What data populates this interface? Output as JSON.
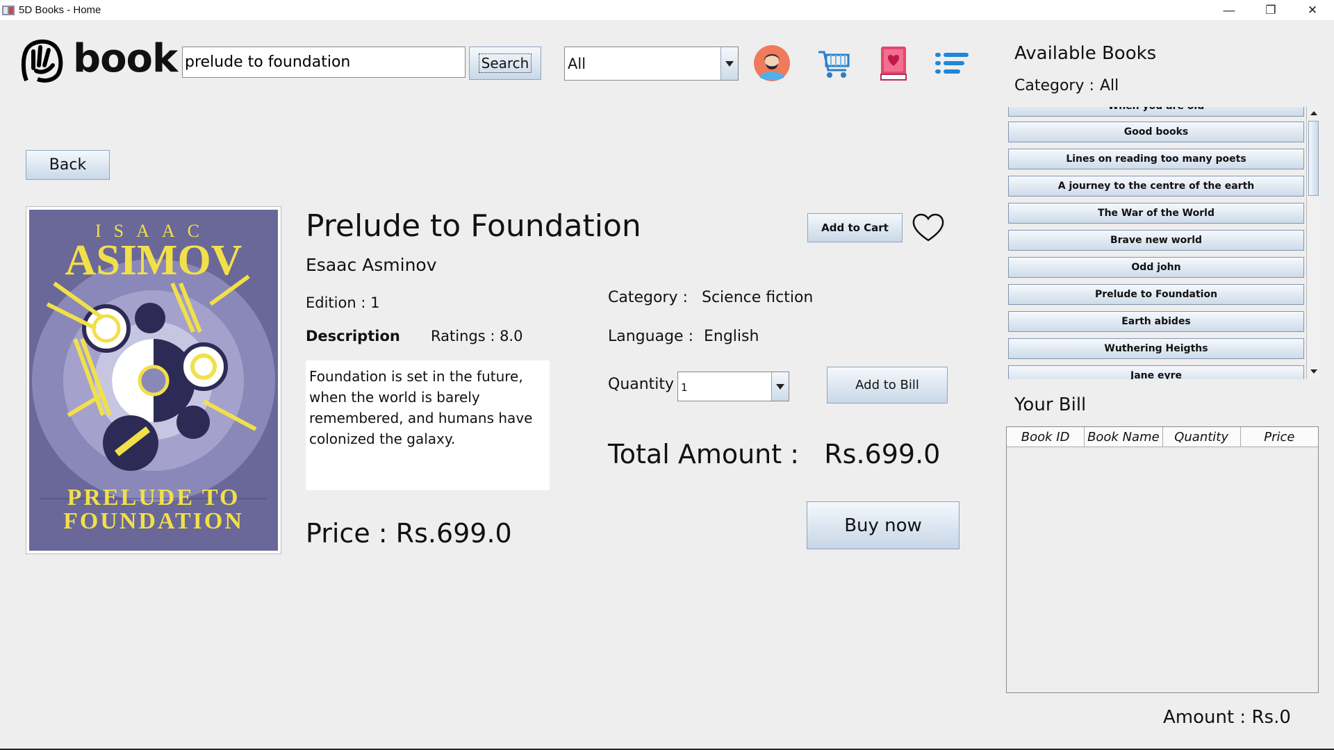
{
  "window": {
    "title": "5D Books - Home",
    "controls": {
      "minimize": "—",
      "maximize": "❐",
      "close": "✕"
    }
  },
  "header": {
    "logo_text": "book",
    "search_value": "prelude to foundation",
    "search_button": "Search",
    "category_select": "All",
    "icons": [
      "profile-avatar-icon",
      "shopping-cart-icon",
      "wishlist-book-icon",
      "menu-list-icon"
    ]
  },
  "back_button": "Back",
  "book": {
    "cover": {
      "author_line": "ISAAC",
      "author_big": "ASIMOV",
      "title_line1": "PRELUDE TO",
      "title_line2": "FOUNDATION"
    },
    "title": "Prelude to Foundation",
    "author": "Esaac Asminov",
    "edition_label": "Edition : 1",
    "description_label": "Description",
    "ratings_label": "Ratings : 8.0",
    "description": "Foundation is set in the future, when the world is barely remembered, and humans have colonized the galaxy.",
    "price_label": "Price : Rs.699.0",
    "category_label": "Category :",
    "category_value": "Science fiction",
    "language_label": "Language :",
    "language_value": "English",
    "quantity_label": "Quantity",
    "quantity_value": "1",
    "add_to_bill": "Add to Bill",
    "add_to_cart": "Add to Cart",
    "total_label": "Total Amount :   Rs.699.0",
    "buy_now": "Buy now"
  },
  "available_books": {
    "title": "Available Books",
    "category_label": "Category  :",
    "category_value": "All",
    "items": [
      "When you are old",
      "Good books",
      "Lines on reading too many poets",
      "A journey to the centre of the earth",
      "The War of the World",
      "Brave new world",
      "Odd john",
      "Prelude to Foundation",
      "Earth abides",
      "Wuthering Heigths",
      "Jane eyre"
    ]
  },
  "bill": {
    "title": "Your Bill",
    "columns": [
      "Book ID",
      "Book Name",
      "Quantity",
      "Price"
    ],
    "amount_label": "Amount : Rs.0"
  },
  "colors": {
    "accent_blue": "#1e88d8",
    "button_top": "#f4f8fc",
    "button_bottom": "#c9d8e8",
    "cover_purple": "#5c5a8f",
    "cover_yellow": "#f1e04a"
  }
}
